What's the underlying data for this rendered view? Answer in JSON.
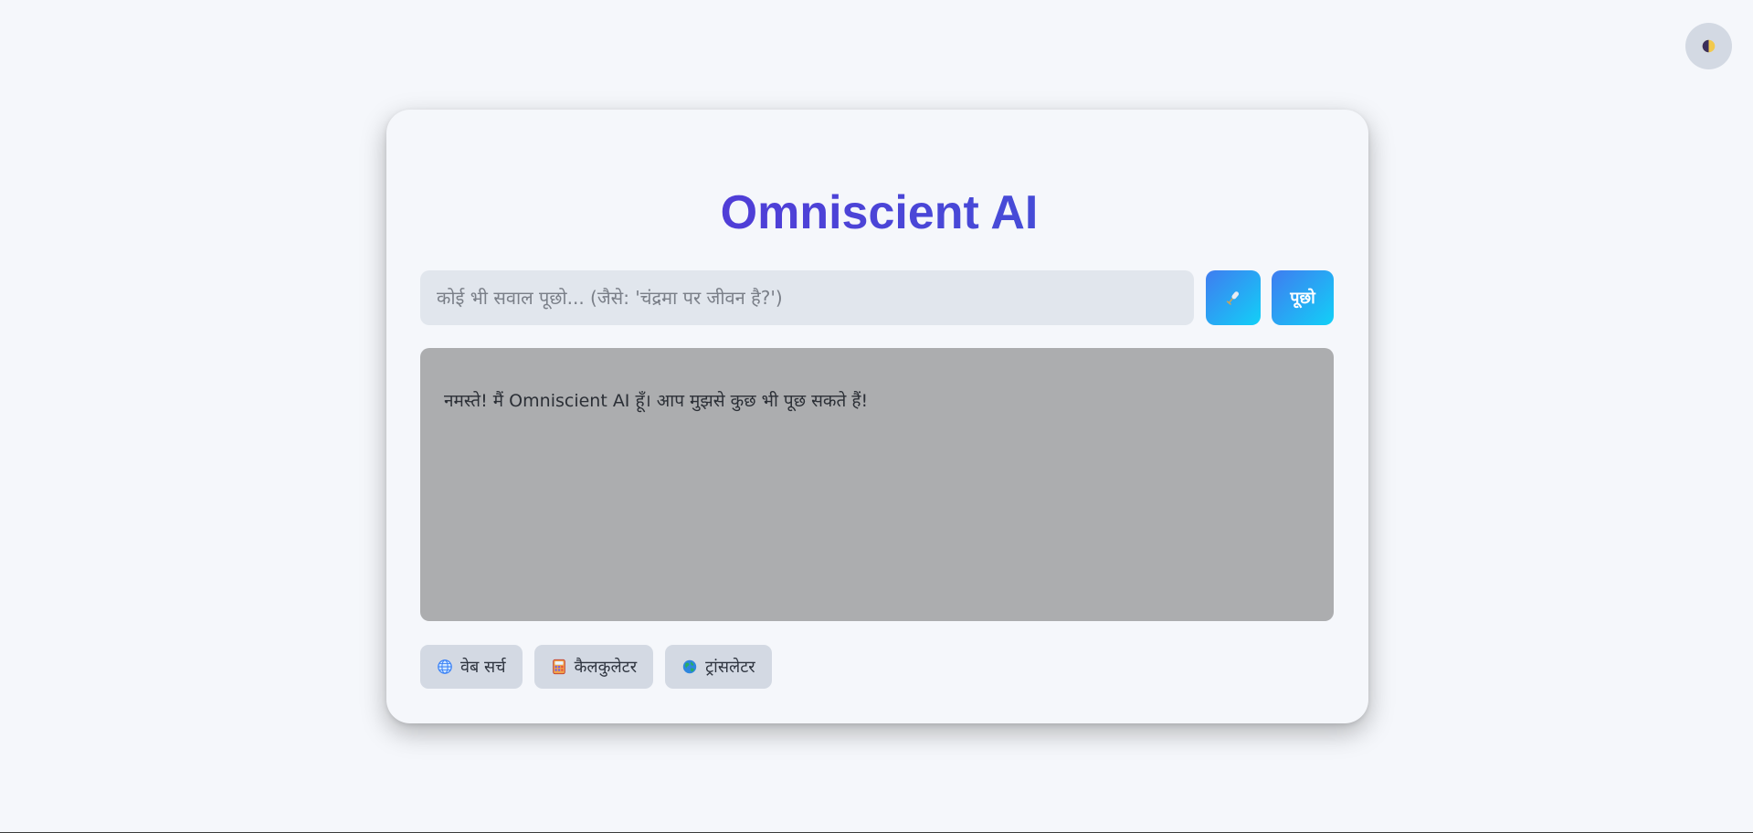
{
  "app": {
    "title": "Omniscient AI"
  },
  "header": {
    "theme_toggle_icon": "half-moon-contrast-icon"
  },
  "search": {
    "placeholder": "कोई भी सवाल पूछो... (जैसे: 'चंद्रमा पर जीवन है?')",
    "value": "",
    "mic_icon": "microphone-icon",
    "ask_label": "पूछो"
  },
  "response": {
    "message": "नमस्ते! मैं Omniscient AI हूँ। आप मुझसे कुछ भी पूछ सकते हैं!"
  },
  "tools": [
    {
      "label": "वेब सर्च",
      "icon": "globe-icon"
    },
    {
      "label": "कैलकुलेटर",
      "icon": "calculator-icon"
    },
    {
      "label": "ट्रांसलेटर",
      "icon": "earth-icon"
    }
  ],
  "colors": {
    "page_bg": "#f5f7fb",
    "title_gradient_start": "#5a2fd6",
    "title_gradient_end": "#3c5ad8",
    "button_gradient_start": "#3f7cf0",
    "button_gradient_end": "#12d0f7",
    "input_bg": "#e1e6ed",
    "response_bg": "#acadaf",
    "tool_bg": "#d3d9e3"
  }
}
